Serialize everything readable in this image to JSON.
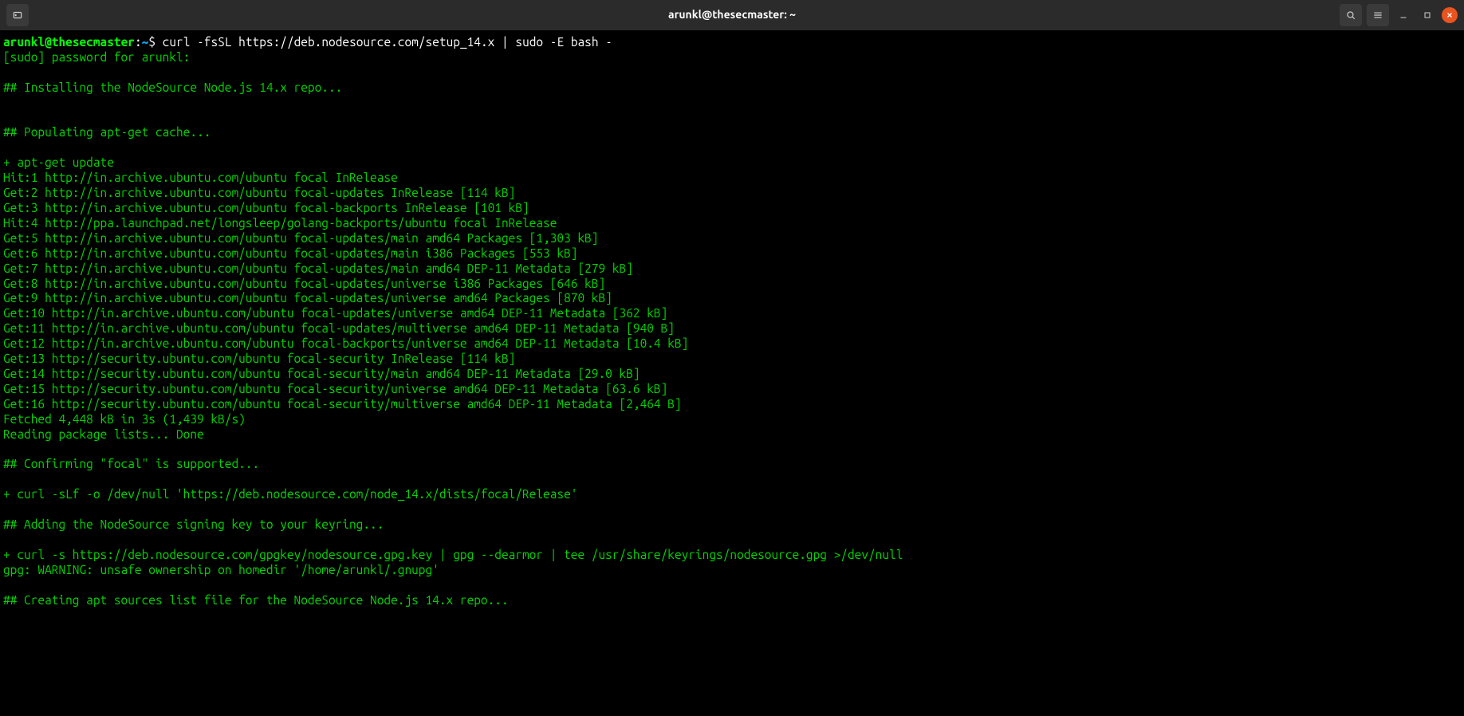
{
  "titlebar": {
    "title": "arunkl@thesecmaster: ~"
  },
  "prompt": {
    "user": "arunkl",
    "at": "@",
    "host": "thesecmaster",
    "sep1": ":",
    "path": "~",
    "sep2": "$ "
  },
  "command": "curl -fsSL https://deb.nodesource.com/setup_14.x | sudo -E bash -",
  "output": [
    "[sudo] password for arunkl:",
    "",
    "## Installing the NodeSource Node.js 14.x repo...",
    "",
    "",
    "## Populating apt-get cache...",
    "",
    "+ apt-get update",
    "Hit:1 http://in.archive.ubuntu.com/ubuntu focal InRelease",
    "Get:2 http://in.archive.ubuntu.com/ubuntu focal-updates InRelease [114 kB]",
    "Get:3 http://in.archive.ubuntu.com/ubuntu focal-backports InRelease [101 kB]",
    "Hit:4 http://ppa.launchpad.net/longsleep/golang-backports/ubuntu focal InRelease",
    "Get:5 http://in.archive.ubuntu.com/ubuntu focal-updates/main amd64 Packages [1,303 kB]",
    "Get:6 http://in.archive.ubuntu.com/ubuntu focal-updates/main i386 Packages [553 kB]",
    "Get:7 http://in.archive.ubuntu.com/ubuntu focal-updates/main amd64 DEP-11 Metadata [279 kB]",
    "Get:8 http://in.archive.ubuntu.com/ubuntu focal-updates/universe i386 Packages [646 kB]",
    "Get:9 http://in.archive.ubuntu.com/ubuntu focal-updates/universe amd64 Packages [870 kB]",
    "Get:10 http://in.archive.ubuntu.com/ubuntu focal-updates/universe amd64 DEP-11 Metadata [362 kB]",
    "Get:11 http://in.archive.ubuntu.com/ubuntu focal-updates/multiverse amd64 DEP-11 Metadata [940 B]",
    "Get:12 http://in.archive.ubuntu.com/ubuntu focal-backports/universe amd64 DEP-11 Metadata [10.4 kB]",
    "Get:13 http://security.ubuntu.com/ubuntu focal-security InRelease [114 kB]",
    "Get:14 http://security.ubuntu.com/ubuntu focal-security/main amd64 DEP-11 Metadata [29.0 kB]",
    "Get:15 http://security.ubuntu.com/ubuntu focal-security/universe amd64 DEP-11 Metadata [63.6 kB]",
    "Get:16 http://security.ubuntu.com/ubuntu focal-security/multiverse amd64 DEP-11 Metadata [2,464 B]",
    "Fetched 4,448 kB in 3s (1,439 kB/s)",
    "Reading package lists... Done",
    "",
    "## Confirming \"focal\" is supported...",
    "",
    "+ curl -sLf -o /dev/null 'https://deb.nodesource.com/node_14.x/dists/focal/Release'",
    "",
    "## Adding the NodeSource signing key to your keyring...",
    "",
    "+ curl -s https://deb.nodesource.com/gpgkey/nodesource.gpg.key | gpg --dearmor | tee /usr/share/keyrings/nodesource.gpg >/dev/null",
    "gpg: WARNING: unsafe ownership on homedir '/home/arunkl/.gnupg'",
    "",
    "## Creating apt sources list file for the NodeSource Node.js 14.x repo..."
  ]
}
